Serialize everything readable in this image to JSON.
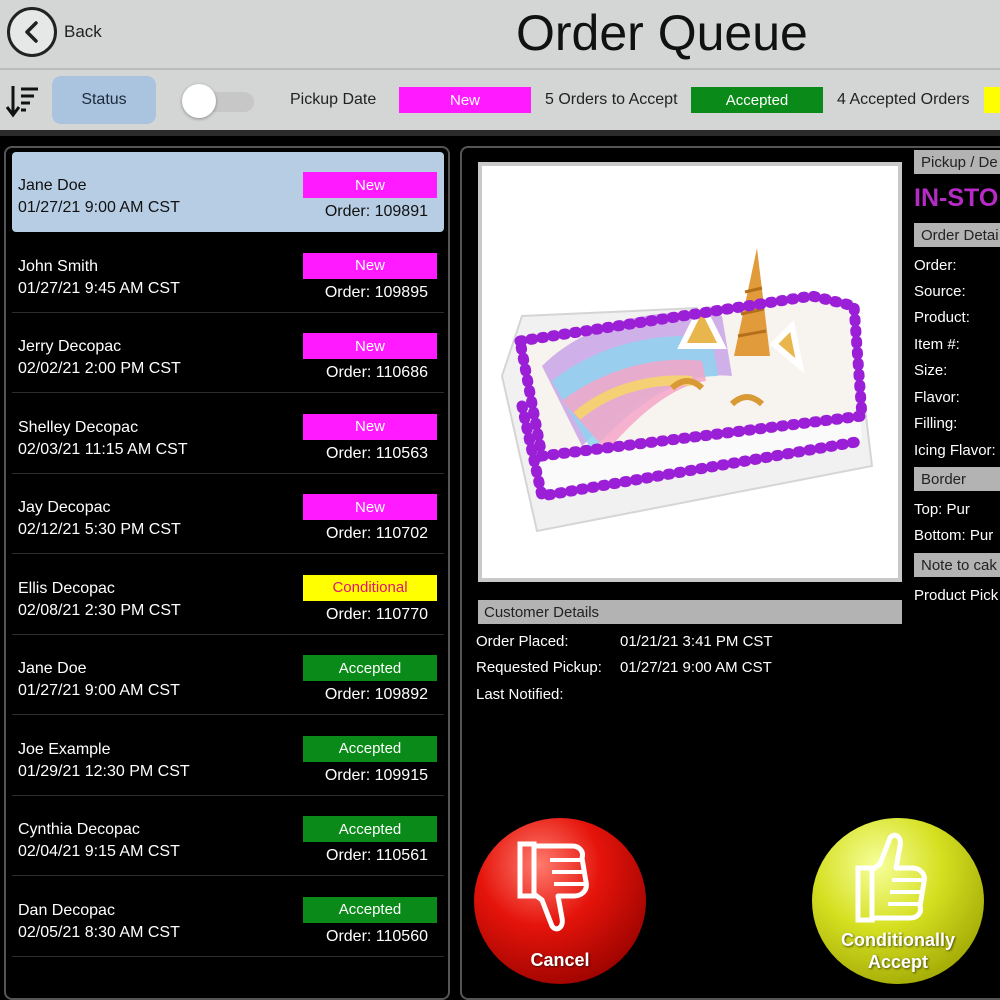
{
  "header": {
    "back_label": "Back",
    "title": "Order Queue"
  },
  "toolbar": {
    "status_button": "Status",
    "toggle_on": false,
    "pickup_date_label": "Pickup Date",
    "legend": [
      {
        "label": "New",
        "color": "#ff1aff",
        "count_text": "5 Orders to Accept"
      },
      {
        "label": "Accepted",
        "color": "#0a8a18",
        "count_text": "4 Accepted Orders"
      },
      {
        "label": "",
        "color": "#ffff00",
        "count_text": ""
      }
    ]
  },
  "orders": [
    {
      "name": "Jane Doe",
      "date": "01/27/21 9:00 AM CST",
      "status": "New",
      "order": "Order: 109891",
      "selected": true
    },
    {
      "name": "John Smith",
      "date": "01/27/21 9:45 AM CST",
      "status": "New",
      "order": "Order: 109895",
      "selected": false
    },
    {
      "name": "Jerry Decopac",
      "date": "02/02/21 2:00 PM CST",
      "status": "New",
      "order": "Order: 110686",
      "selected": false
    },
    {
      "name": "Shelley Decopac",
      "date": "02/03/21 11:15 AM CST",
      "status": "New",
      "order": "Order: 110563",
      "selected": false
    },
    {
      "name": "Jay Decopac",
      "date": "02/12/21 5:30 PM CST",
      "status": "New",
      "order": "Order: 110702",
      "selected": false
    },
    {
      "name": "Ellis Decopac",
      "date": "02/08/21 2:30 PM CST",
      "status": "Conditional",
      "order": "Order: 110770",
      "selected": false
    },
    {
      "name": "Jane Doe",
      "date": "01/27/21 9:00 AM CST",
      "status": "Accepted",
      "order": "Order: 109892",
      "selected": false
    },
    {
      "name": "Joe Example",
      "date": "01/29/21 12:30 PM CST",
      "status": "Accepted",
      "order": "Order: 109915",
      "selected": false
    },
    {
      "name": "Cynthia Decopac",
      "date": "02/04/21 9:15 AM CST",
      "status": "Accepted",
      "order": "Order: 110561",
      "selected": false
    },
    {
      "name": "Dan Decopac",
      "date": "02/05/21 8:30 AM CST",
      "status": "Accepted",
      "order": "Order: 110560",
      "selected": false
    }
  ],
  "status_colors": {
    "New": {
      "bg": "#ff1aff",
      "fg": "#ffffff"
    },
    "Conditional": {
      "bg": "#ffff00",
      "fg": "#e0147a"
    },
    "Accepted": {
      "bg": "#0a8a18",
      "fg": "#ffffff"
    }
  },
  "customer_details": {
    "header": "Customer Details",
    "rows": [
      {
        "label": "Order Placed:",
        "value": "01/21/21 3:41 PM CST"
      },
      {
        "label": "Requested Pickup:",
        "value": "01/27/21 9:00 AM CST"
      },
      {
        "label": "Last Notified:",
        "value": ""
      }
    ]
  },
  "side_panel": {
    "pickup_header": "Pickup / De",
    "pickup_type": "IN-STO",
    "order_details_header": "Order Detai",
    "fields": [
      "Order:",
      "Source:",
      "Product:",
      "Item #:",
      "Size:",
      "Flavor:",
      "Filling:",
      "Icing Flavor:"
    ],
    "border_header": "Border",
    "border_fields": [
      "Top:   Pur",
      "Bottom:  Pur"
    ],
    "note_header": "Note to cak",
    "product_pick": "Product Pick"
  },
  "actions": {
    "cancel_label": "Cancel",
    "conditional_line1": "Conditionally",
    "conditional_line2": "Accept"
  }
}
